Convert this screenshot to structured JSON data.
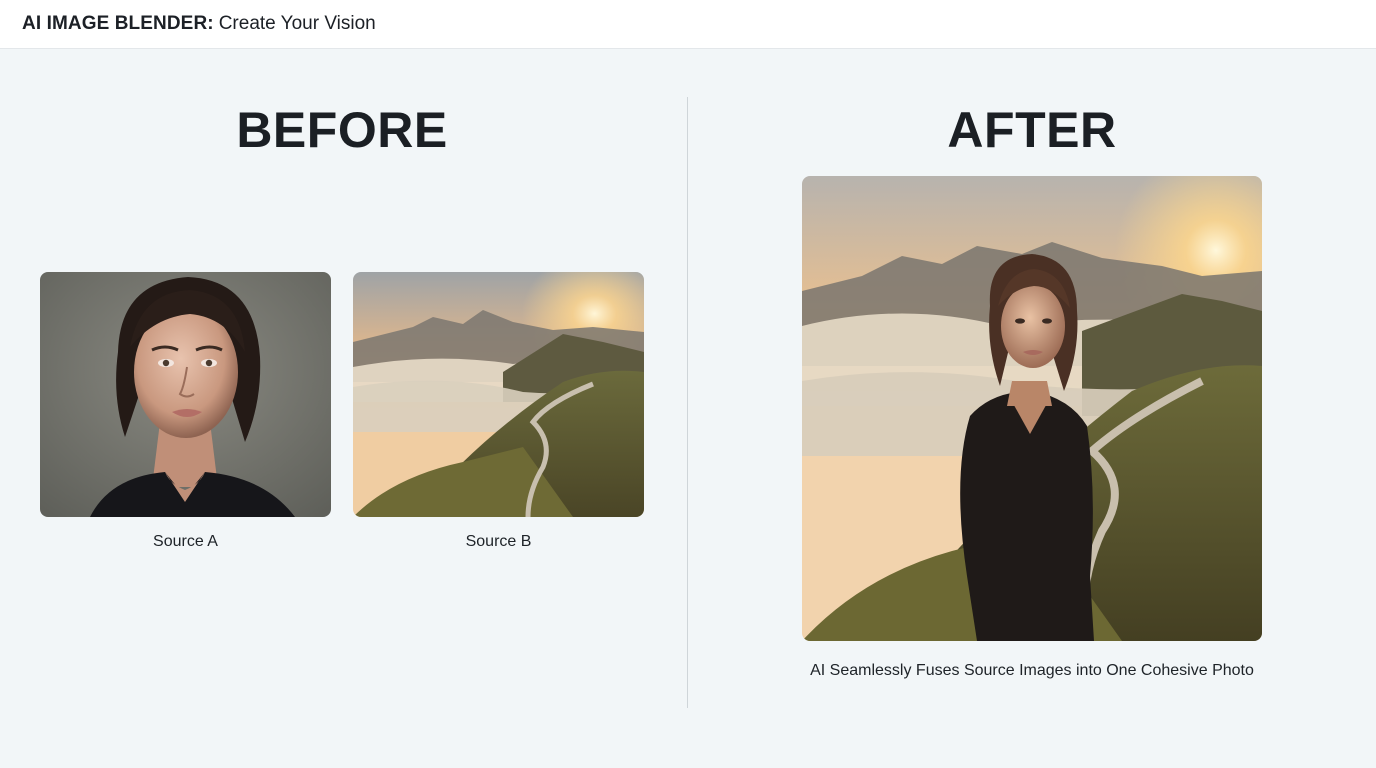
{
  "header": {
    "brand": "AI IMAGE BLENDER:",
    "tagline": "Create Your Vision"
  },
  "before": {
    "title": "BEFORE",
    "images": [
      {
        "caption": "Source A",
        "icon": "portrait-photo"
      },
      {
        "caption": "Source B",
        "icon": "mountain-landscape-photo"
      }
    ]
  },
  "after": {
    "title": "AFTER",
    "caption": "AI Seamlessly Fuses Source Images into One Cohesive Photo",
    "icon": "blended-portrait-landscape-photo"
  },
  "colors": {
    "background": "#f2f6f8",
    "text": "#1b1f24",
    "divider": "#cfd5d9"
  }
}
